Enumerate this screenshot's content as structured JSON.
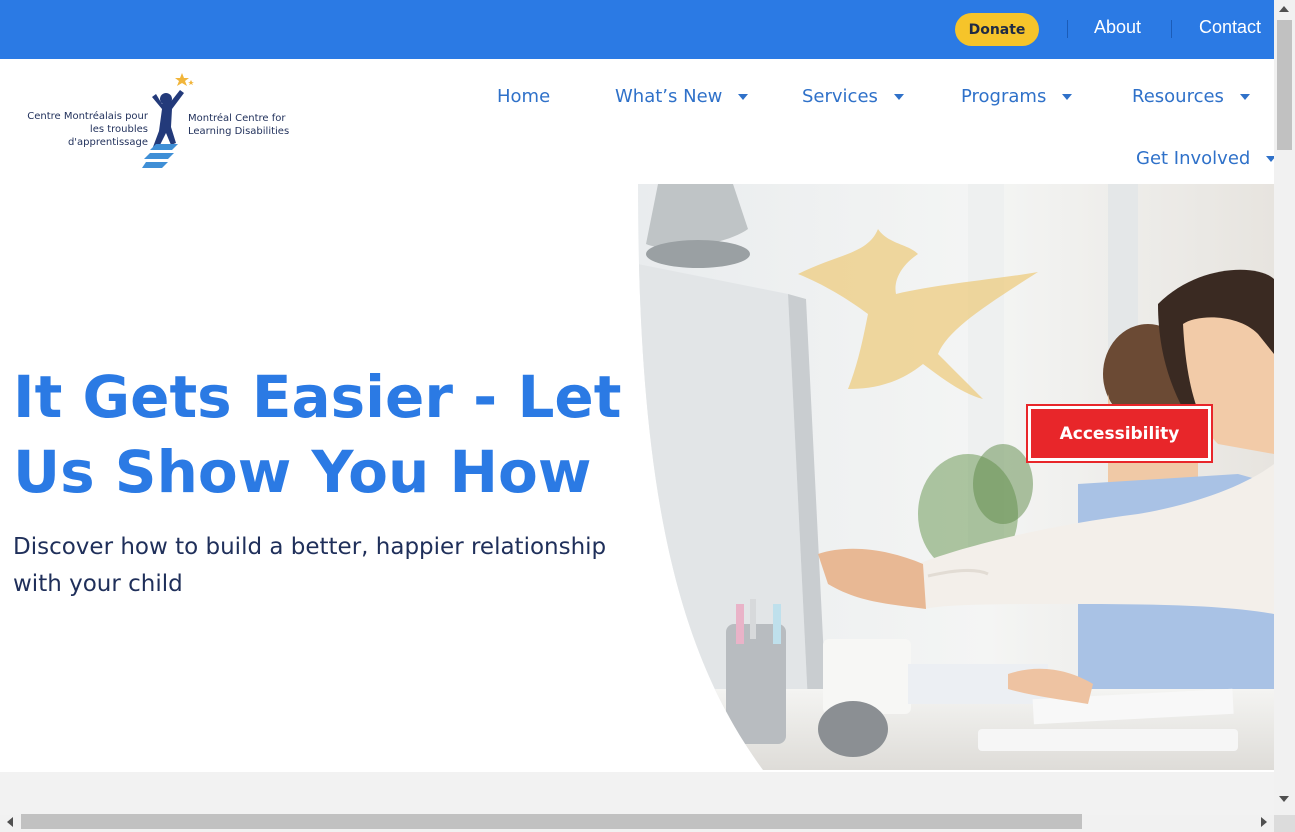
{
  "topbar": {
    "donate_label": "Donate",
    "about_label": "About",
    "contact_label": "Contact"
  },
  "logo": {
    "fr_line1": "Centre Montréalais pour",
    "fr_line2": "les troubles d'apprentissage",
    "en_line1": "Montréal Centre for",
    "en_line2": "Learning Disabilities"
  },
  "nav": {
    "home": "Home",
    "whats_new": "What’s New",
    "services": "Services",
    "programs": "Programs",
    "resources": "Resources",
    "get_involved": "Get Involved"
  },
  "hero": {
    "title_line1": "It Gets Easier - Let",
    "title_line2": "Us Show You How",
    "subtitle_line1": "Discover how to build a better, happier relationship",
    "subtitle_line2": "with your child"
  },
  "accessibility_label": "Accessibility",
  "colors": {
    "brand_blue": "#2b7ae4",
    "donate_yellow": "#f6c42a",
    "accessibility_red": "#e8262a",
    "navy_text": "#1f2f5a"
  }
}
